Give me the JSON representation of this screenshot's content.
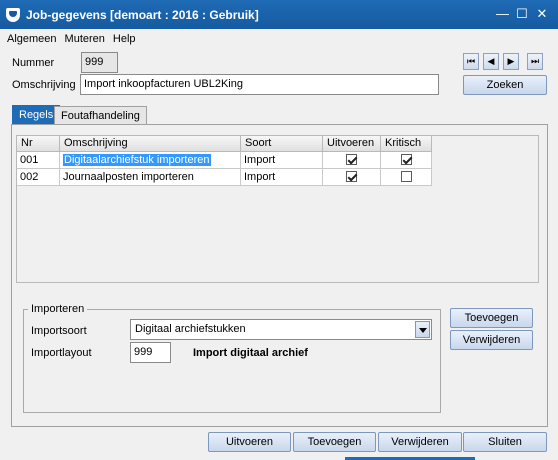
{
  "window": {
    "title": "Job-gegevens [demoart : 2016 : Gebruik]",
    "min_glyph": "—",
    "max_glyph": "☐",
    "close_glyph": "✕"
  },
  "menu": [
    "Algemeen",
    "Muteren",
    "Help"
  ],
  "form": {
    "nummer_label": "Nummer",
    "nummer_value": "999",
    "omschrijving_label": "Omschrijving",
    "omschrijving_value": "Import inkoopfacturen UBL2King"
  },
  "nav": {
    "first": "⏮",
    "prev": "◀",
    "next": "▶",
    "last": "⏭"
  },
  "zoeken_label": "Zoeken",
  "tabs": [
    "Regels",
    "Foutafhandeling"
  ],
  "grid": {
    "columns": [
      "Nr",
      "Omschrijving",
      "Soort",
      "Uitvoeren",
      "Kritisch"
    ],
    "rows": [
      {
        "nr": "001",
        "omschrijving": "Digitaalarchiefstuk importeren",
        "soort": "Import",
        "uitvoeren": true,
        "kritisch": true
      },
      {
        "nr": "002",
        "omschrijving": "Journaalposten importeren",
        "soort": "Import",
        "uitvoeren": true,
        "kritisch": false
      }
    ]
  },
  "importeren": {
    "legend": "Importeren",
    "importsoort_label": "Importsoort",
    "importsoort_value": "Digitaal archiefstukken",
    "importlayout_label": "Importlayout",
    "importlayout_value": "999",
    "importlayout_desc": "Import digitaal archief"
  },
  "side_buttons": {
    "toevoegen": "Toevoegen",
    "verwijderen": "Verwijderen"
  },
  "bottom_buttons": {
    "uitvoeren": "Uitvoeren",
    "toevoegen": "Toevoegen",
    "verwijderen": "Verwijderen",
    "sluiten": "Sluiten"
  },
  "colors": {
    "titlebar": "#1f6bb5",
    "selection": "#3399ff"
  }
}
